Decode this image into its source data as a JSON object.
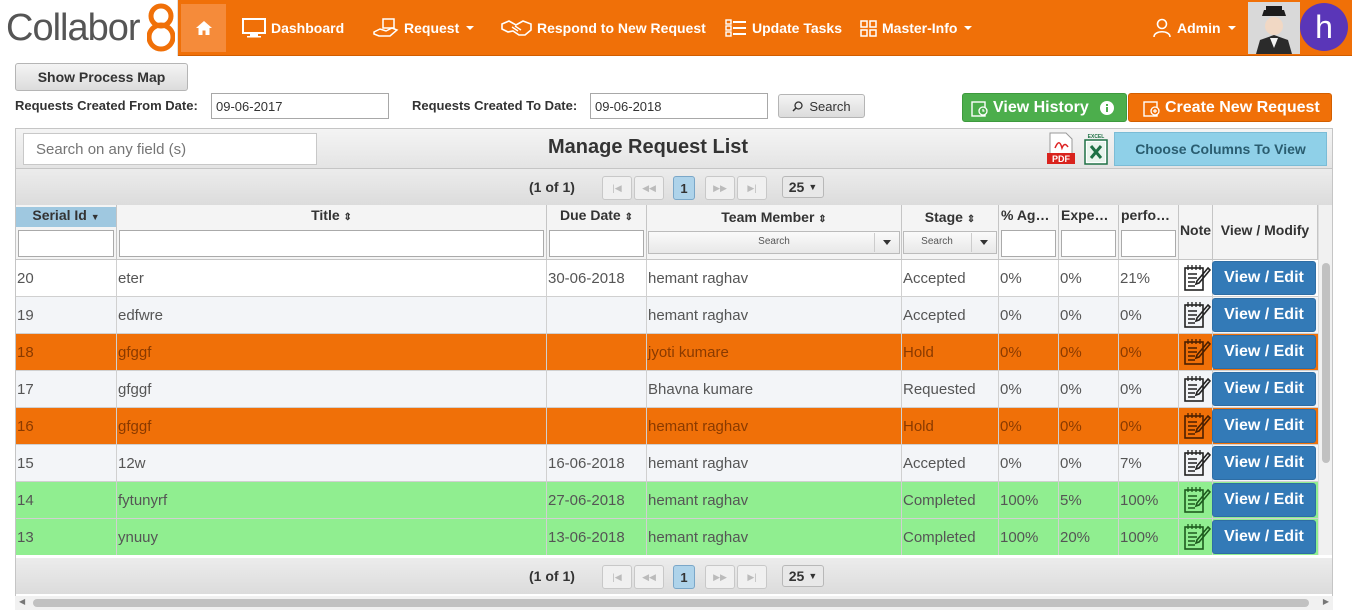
{
  "brand": {
    "logo_text": "Collabor",
    "logo_digit": "8"
  },
  "nav": {
    "dashboard": "Dashboard",
    "request": "Request",
    "respond": "Respond to New Request",
    "update_tasks": "Update Tasks",
    "master_info": "Master-Info",
    "admin": "Admin",
    "avatar_letter": "h"
  },
  "controls": {
    "show_process_map": "Show Process Map",
    "from_label": "Requests Created From Date:",
    "from_value": "09-06-2017",
    "to_label": "Requests Created To Date:",
    "to_value": "09-06-2018",
    "search_label": "Search",
    "view_history": "View History",
    "create_request": "Create New Request"
  },
  "panel": {
    "search_placeholder": "Search on any field (s)",
    "title": "Manage Request List",
    "pdf_label": "PDF",
    "excel_label": "EXCEL",
    "choose_columns": "Choose Columns To View"
  },
  "paginator": {
    "page_text": "(1 of 1)",
    "current_page": "1",
    "rows_per_page": "25"
  },
  "columns": {
    "serial": "Serial Id",
    "title": "Title",
    "due": "Due Date",
    "member": "Team Member",
    "stage": "Stage",
    "age": "% Ag…",
    "expe": "Expe…",
    "perf": "perfo…",
    "note": "Note",
    "view": "View / Modify",
    "member_filter": "Search",
    "stage_filter": "Search"
  },
  "rows": [
    {
      "id": "20",
      "title": "eter",
      "due": "30-06-2018",
      "member": "hemant raghav",
      "stage": "Accepted",
      "age": "0%",
      "expe": "0%",
      "perf": "21%",
      "action": "View / Edit"
    },
    {
      "id": "19",
      "title": "edfwre",
      "due": "",
      "member": "hemant raghav",
      "stage": "Accepted",
      "age": "0%",
      "expe": "0%",
      "perf": "0%",
      "action": "View / Edit"
    },
    {
      "id": "18",
      "title": "gfggf",
      "due": "",
      "member": "jyoti kumare",
      "stage": "Hold",
      "age": "0%",
      "expe": "0%",
      "perf": "0%",
      "action": "View / Edit"
    },
    {
      "id": "17",
      "title": "gfggf",
      "due": "",
      "member": "Bhavna kumare",
      "stage": "Requested",
      "age": "0%",
      "expe": "0%",
      "perf": "0%",
      "action": "View / Edit"
    },
    {
      "id": "16",
      "title": "gfggf",
      "due": "",
      "member": "hemant raghav",
      "stage": "Hold",
      "age": "0%",
      "expe": "0%",
      "perf": "0%",
      "action": "View / Edit"
    },
    {
      "id": "15",
      "title": "12w",
      "due": "16-06-2018",
      "member": "hemant raghav",
      "stage": "Accepted",
      "age": "0%",
      "expe": "0%",
      "perf": "7%",
      "action": "View / Edit"
    },
    {
      "id": "14",
      "title": "fytunyrf",
      "due": "27-06-2018",
      "member": "hemant raghav",
      "stage": "Completed",
      "age": "100%",
      "expe": "5%",
      "perf": "100%",
      "action": "View / Edit"
    },
    {
      "id": "13",
      "title": "ynuuy",
      "due": "13-06-2018",
      "member": "hemant raghav",
      "stage": "Completed",
      "age": "100%",
      "expe": "20%",
      "perf": "100%",
      "action": "View / Edit"
    }
  ],
  "colors": {
    "brand_orange": "#f07008",
    "hold_row": "#f07008",
    "completed_row": "#90ee90",
    "action_blue": "#337ab7",
    "history_green": "#4cae4c"
  }
}
